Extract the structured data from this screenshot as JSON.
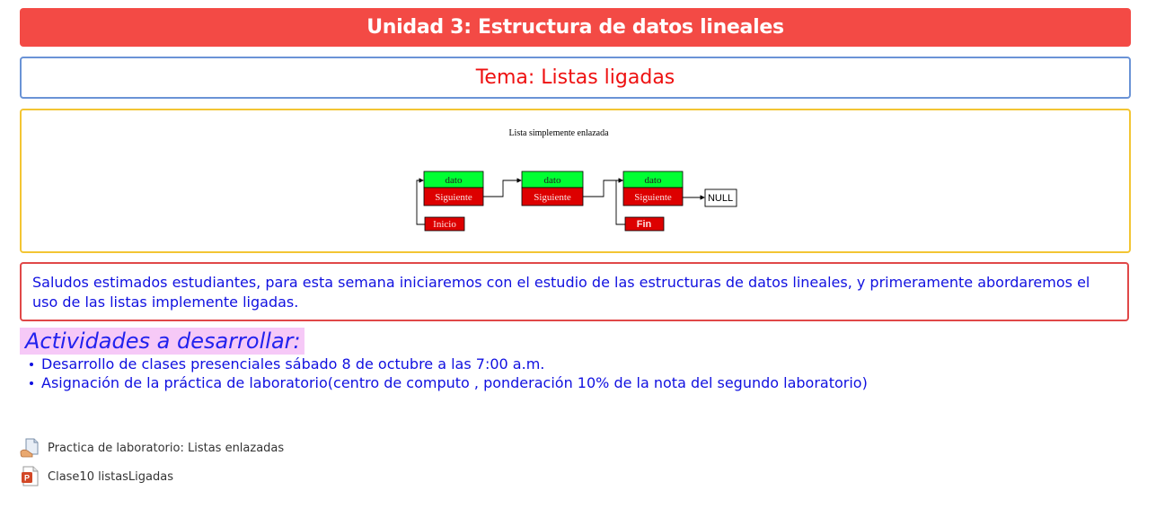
{
  "header": {
    "unit_title": "Unidad 3: Estructura de datos lineales",
    "topic_title": "Tema: Listas ligadas"
  },
  "diagram": {
    "caption": "Lista simplemente enlazada",
    "node_labels": [
      "dato",
      "Siguiente"
    ],
    "start_label": "Inicio",
    "end_label": "Fin",
    "null_label": "NULL"
  },
  "message": {
    "text": "Saludos estimados estudiantes, para esta semana iniciaremos con el estudio de las estructuras de datos lineales, y primeramente abordaremos el uso de las listas implemente ligadas."
  },
  "activities": {
    "title": "Actividades a desarrollar:",
    "items": [
      "Desarrollo de clases presenciales sábado 8 de octubre a las 7:00 a.m.",
      "Asignación de la práctica de laboratorio(centro de computo , ponderación 10% de la nota del segundo laboratorio)"
    ]
  },
  "resources": [
    {
      "label": "Practica de laboratorio: Listas enlazadas",
      "icon": "assignment-icon"
    },
    {
      "label": "Clase10 listasLigadas",
      "icon": "powerpoint-file-icon"
    }
  ],
  "colors": {
    "banner": "#f34a45",
    "topic_border": "#6a93d6",
    "topic_text": "#ee1111",
    "diagram_border": "#f3c533",
    "message_border": "#e04848",
    "body_text": "#1010e0",
    "activities_bg": "#f6c9f7",
    "node_data": "#00ff33",
    "node_next": "#dd0000"
  }
}
